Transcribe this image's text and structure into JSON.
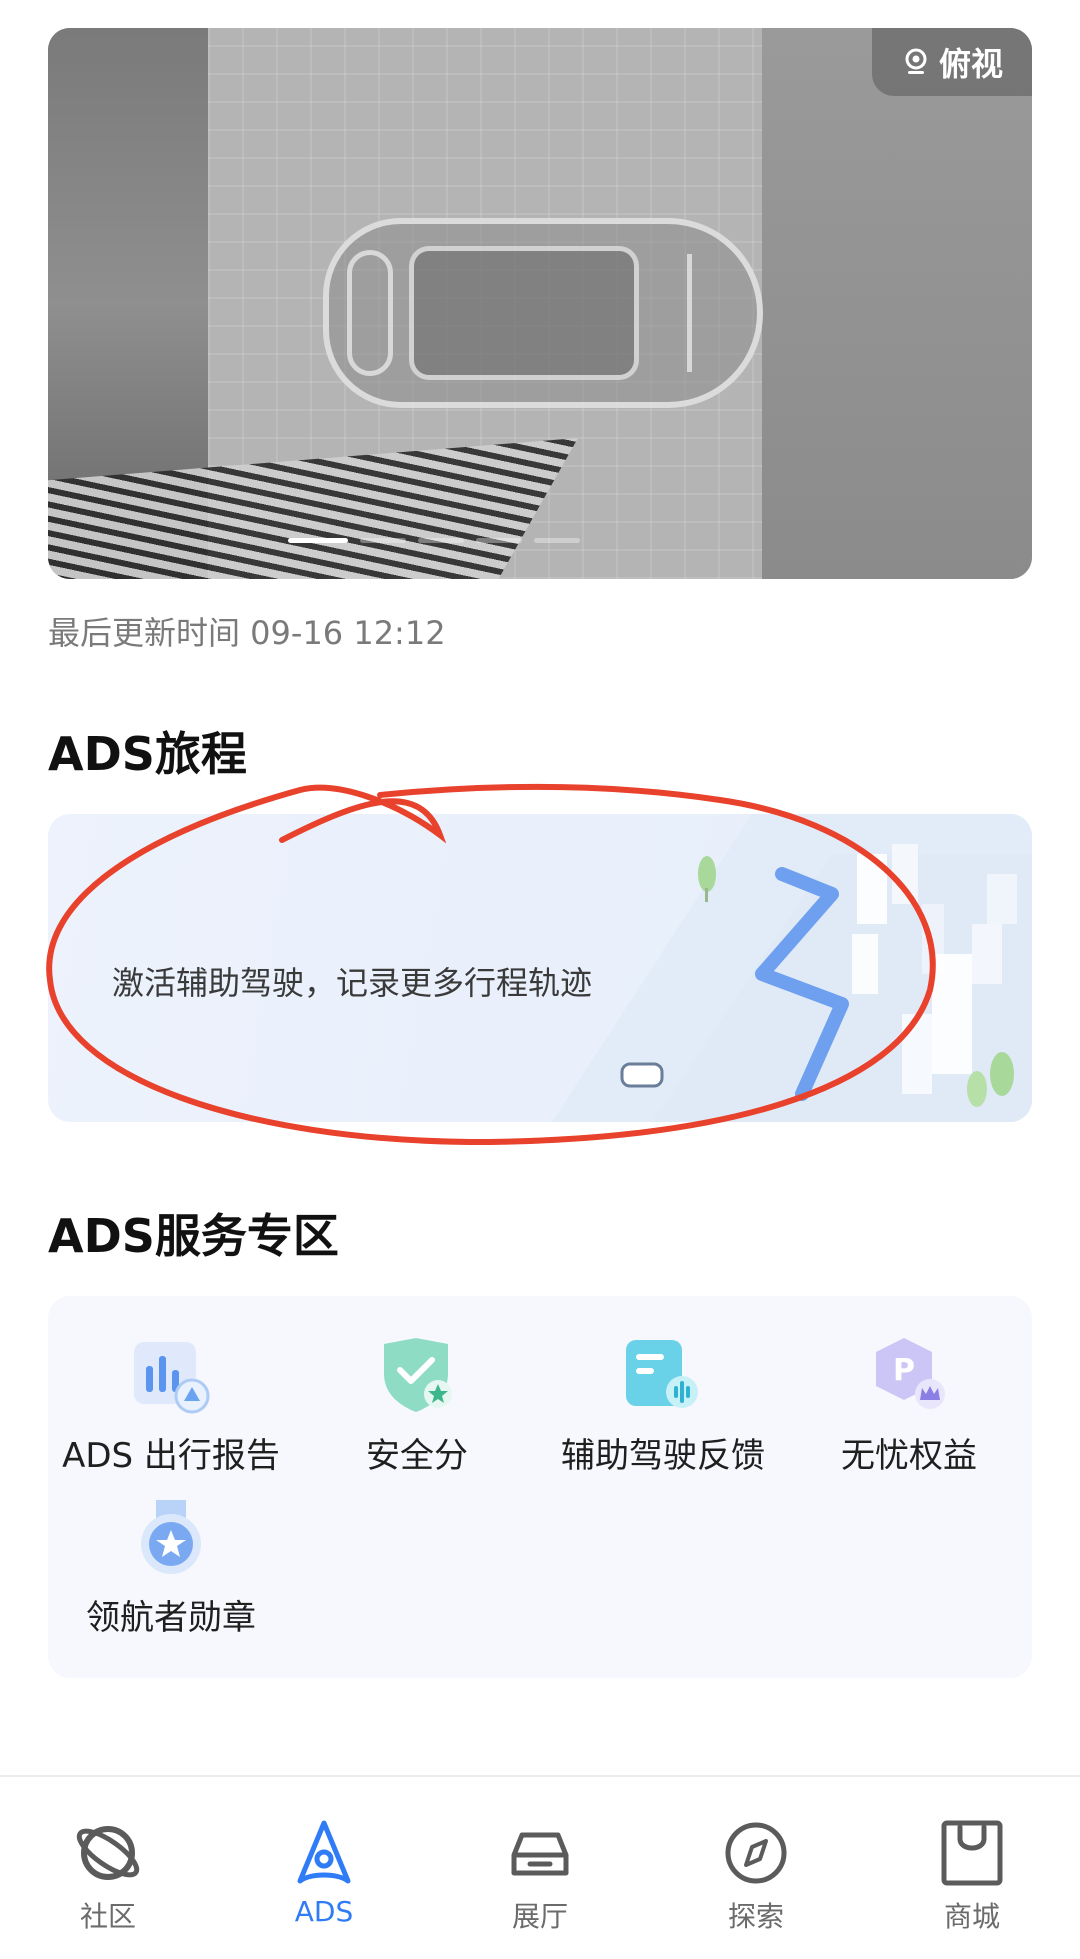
{
  "camera": {
    "view_label": "俯视",
    "view_icon": "camera-icon",
    "pages": 5,
    "active_page": 1
  },
  "update_time": "最后更新时间 09-16 12:12",
  "trip": {
    "title": "ADS旅程",
    "message": "激活辅助驾驶，记录更多行程轨迹"
  },
  "services": {
    "title": "ADS服务专区",
    "items": [
      {
        "label": "ADS 出行报告",
        "icon": "report-chart-icon"
      },
      {
        "label": "安全分",
        "icon": "safety-shield-icon"
      },
      {
        "label": "辅助驾驶反馈",
        "icon": "feedback-icon"
      },
      {
        "label": "无忧权益",
        "icon": "parking-crown-icon"
      },
      {
        "label": "领航者勋章",
        "icon": "medal-icon"
      }
    ]
  },
  "nav": {
    "items": [
      {
        "label": "社区",
        "icon": "planet-icon"
      },
      {
        "label": "ADS",
        "icon": "ads-logo-icon"
      },
      {
        "label": "展厅",
        "icon": "car-icon"
      },
      {
        "label": "探索",
        "icon": "compass-icon"
      },
      {
        "label": "商城",
        "icon": "shopping-bag-icon"
      }
    ],
    "active": "ADS"
  },
  "colors": {
    "accent": "#2f7cf6",
    "annotation": "#e8412c"
  }
}
